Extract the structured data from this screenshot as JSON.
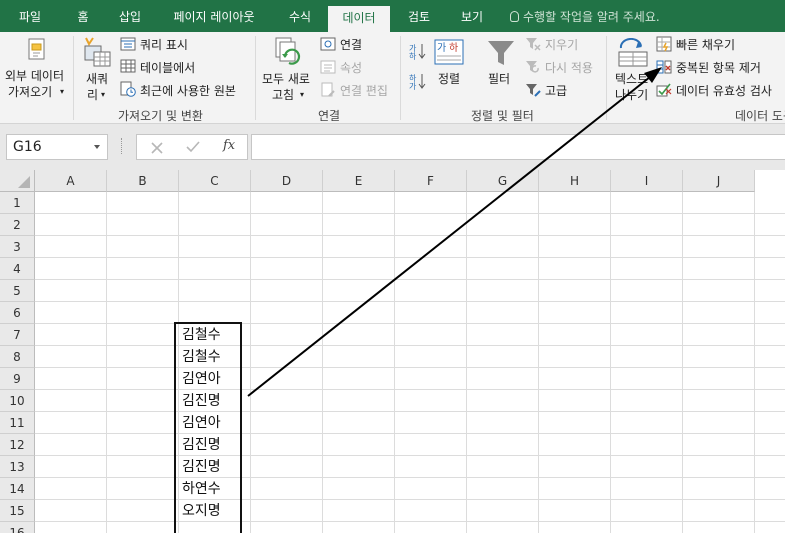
{
  "tabs": [
    {
      "label": "파일",
      "active": false
    },
    {
      "label": "홈",
      "active": false
    },
    {
      "label": "삽입",
      "active": false
    },
    {
      "label": "페이지 레이아웃",
      "active": false
    },
    {
      "label": "수식",
      "active": false
    },
    {
      "label": "데이터",
      "active": true
    },
    {
      "label": "검토",
      "active": false
    },
    {
      "label": "보기",
      "active": false
    }
  ],
  "tell_me": "수행할 작업을 알려 주세요.",
  "ribbon": {
    "get_external": {
      "line1": "외부 데이터",
      "line2": "가져오기"
    },
    "new_query": {
      "line1": "새쿼",
      "line2": "리"
    },
    "show_queries": "쿼리 표시",
    "from_table": "테이블에서",
    "recent_sources": "최근에 사용한 원본",
    "group_get_transform": "가져오기 및 변환",
    "refresh_all": {
      "line1": "모두 새로",
      "line2": "고침"
    },
    "connections": "연결",
    "properties": "속성",
    "edit_links": "연결 편집",
    "group_connections": "연결",
    "sort": "정렬",
    "filter": "필터",
    "clear": "지우기",
    "reapply": "다시 적용",
    "advanced": "고급",
    "group_sort_filter": "정렬 및 필터",
    "text_to_columns": {
      "line1": "텍스트",
      "line2": "나누기"
    },
    "flash_fill": "빠른 채우기",
    "remove_duplicates": "중복된 항목 제거",
    "data_validation": "데이터 유효성 검사",
    "group_data_tools": "데이터 도구"
  },
  "formula_bar": {
    "name_box": "G16",
    "fx": "fx",
    "formula": ""
  },
  "grid": {
    "columns": [
      "A",
      "B",
      "C",
      "D",
      "E",
      "F",
      "G",
      "H",
      "I",
      "J"
    ],
    "rows": [
      "1",
      "2",
      "3",
      "4",
      "5",
      "6",
      "7",
      "8",
      "9",
      "10",
      "11",
      "12",
      "13",
      "14",
      "15",
      "16"
    ],
    "column_c_values": [
      "김철수",
      "김철수",
      "김연아",
      "김진명",
      "김연아",
      "김진명",
      "김진명",
      "하연수",
      "오지명"
    ],
    "data_start_row": 7
  },
  "colors": {
    "excel_green": "#217346",
    "header_bg": "#e9e9e9",
    "gridline": "#dcdcdc"
  }
}
